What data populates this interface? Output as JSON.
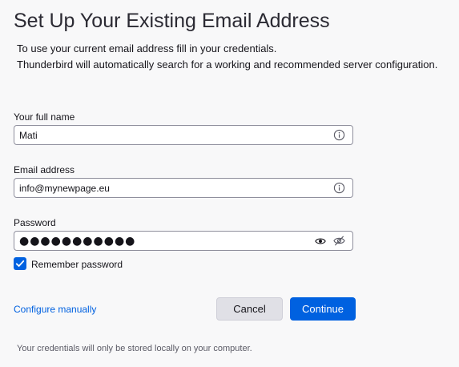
{
  "header": {
    "title": "Set Up Your Existing Email Address",
    "description_line1": "To use your current email address fill in your credentials.",
    "description_line2": "Thunderbird will automatically search for a working and recommended server configuration."
  },
  "form": {
    "full_name": {
      "label": "Your full name",
      "value": "Mati",
      "icon": "info-icon"
    },
    "email": {
      "label": "Email address",
      "value": "info@mynewpage.eu",
      "icon": "info-icon"
    },
    "password": {
      "label": "Password",
      "value": "●●●●●●●●●●●",
      "icons": [
        "eye-icon",
        "eye-off-icon"
      ]
    },
    "remember": {
      "label": "Remember password",
      "checked": true
    }
  },
  "actions": {
    "configure_manually": "Configure manually",
    "cancel": "Cancel",
    "continue": "Continue"
  },
  "footer": {
    "note": "Your credentials will only be stored locally on your computer."
  },
  "colors": {
    "accent": "#0061e0",
    "background": "#f8f8f9",
    "border": "#8f8f9d"
  }
}
